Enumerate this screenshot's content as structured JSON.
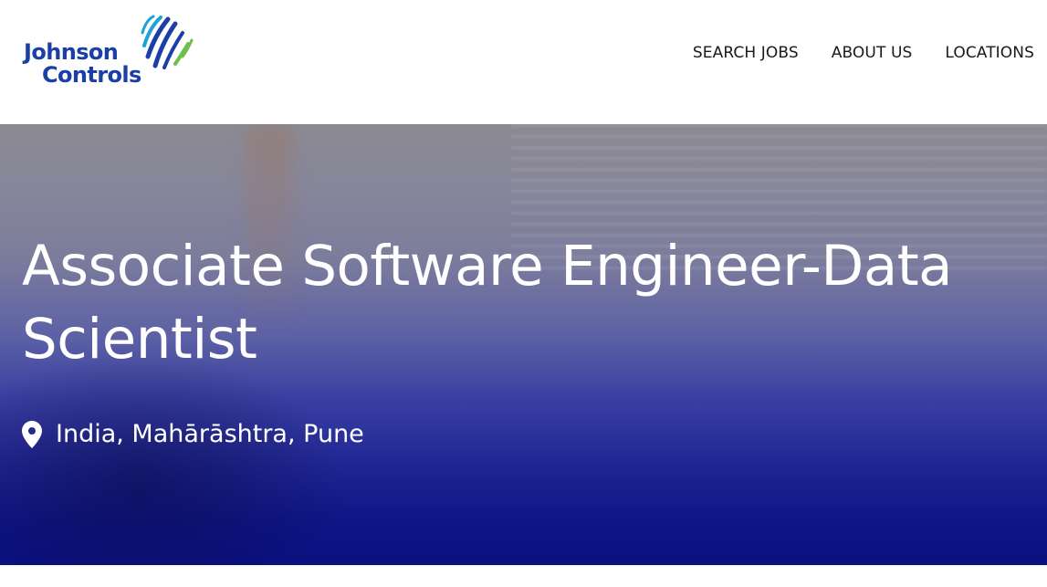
{
  "brand": {
    "logo_line1": "Johnson",
    "logo_line2": "Controls",
    "logo_color": "#1b3fa6",
    "mark_colors": [
      "#1b3fa6",
      "#1fa3d6",
      "#6cc04a"
    ]
  },
  "nav": {
    "items": [
      {
        "label": "SEARCH JOBS"
      },
      {
        "label": "ABOUT US"
      },
      {
        "label": "LOCATIONS"
      }
    ]
  },
  "hero": {
    "title": "Associate Software Engineer-Data Scientist",
    "location": "India, Mahārāshtra, Pune",
    "location_icon": "map-pin-icon",
    "accent_color": "#0a1080"
  }
}
